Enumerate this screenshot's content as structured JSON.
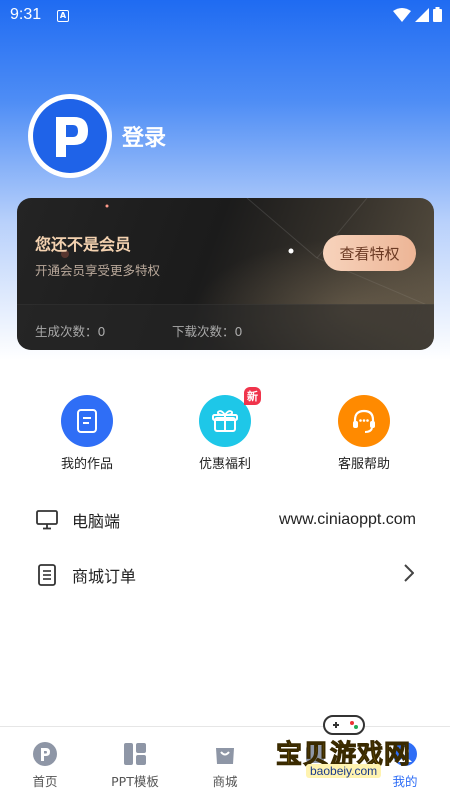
{
  "status_bar": {
    "time": "9:31",
    "indicator": "A"
  },
  "profile": {
    "login_label": "登录",
    "avatar_icon": "p-logo-icon"
  },
  "vip": {
    "title": "您还不是会员",
    "subtitle": "开通会员享受更多特权",
    "button": "查看特权",
    "generate_label": "生成次数：0",
    "download_label": "下载次数：0"
  },
  "quick_actions": [
    {
      "label": "我的作品",
      "icon": "document-icon",
      "color": "#2f6ef6"
    },
    {
      "label": "优惠福利",
      "icon": "gift-icon",
      "color": "#1ec7e8",
      "badge": "新"
    },
    {
      "label": "客服帮助",
      "icon": "headset-icon",
      "color": "#ff8a00"
    }
  ],
  "rows": [
    {
      "label": "电脑端",
      "value": "www.ciniaoppt.com",
      "icon": "monitor-icon"
    },
    {
      "label": "商城订单",
      "icon": "order-list-icon"
    }
  ],
  "nav": [
    {
      "label": "首页",
      "icon": "home-p-icon"
    },
    {
      "label": "PPT模板",
      "icon": "template-icon"
    },
    {
      "label": "商城",
      "icon": "shop-bag-icon"
    },
    {
      "label": "",
      "icon": "partial-icon"
    },
    {
      "label": "我的",
      "icon": "profile-icon",
      "active": true
    }
  ],
  "watermark": {
    "text": "宝贝游戏网",
    "url": "baobeiy.com"
  },
  "colors": {
    "primary": "#2f6ef6",
    "vip_gold": "#f4d2b0"
  }
}
